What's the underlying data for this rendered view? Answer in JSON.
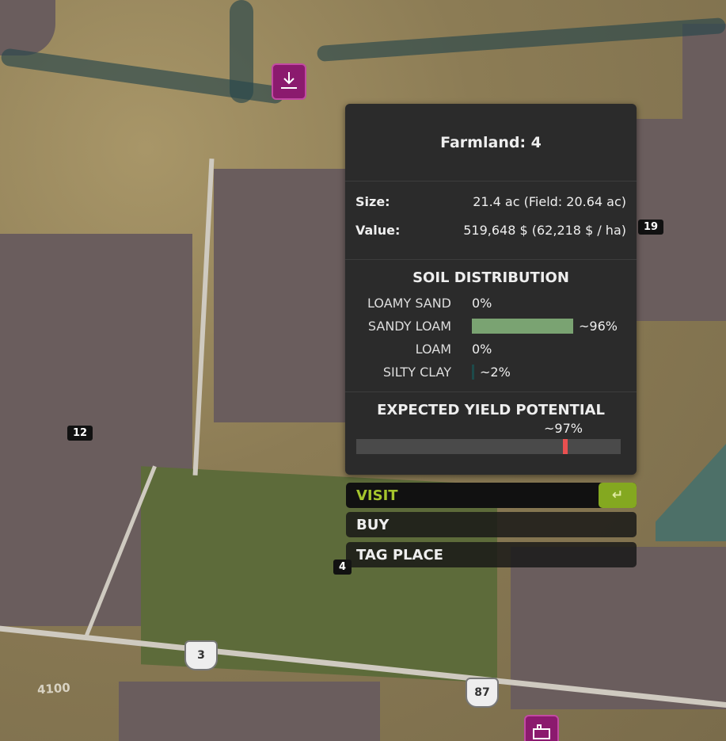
{
  "map": {
    "field_numbers": {
      "left": "12",
      "right": "19",
      "selected": "4"
    },
    "road_shields": {
      "state": "3",
      "us": "87"
    },
    "road_text": "4100",
    "icons": [
      "download-marker-icon",
      "factory-marker-icon"
    ]
  },
  "panel": {
    "title": "Farmland: 4",
    "size_label": "Size:",
    "size_value": "21.4 ac (Field: 20.64 ac)",
    "value_label": "Value:",
    "value_value": "519,648 $ (62,218 $ / ha)"
  },
  "soil": {
    "title": "SOIL DISTRIBUTION",
    "items": [
      {
        "name": "LOAMY SAND",
        "value": "0%",
        "fraction": 0.0
      },
      {
        "name": "SANDY LOAM",
        "value": "~96%",
        "fraction": 0.96
      },
      {
        "name": "LOAM",
        "value": "0%",
        "fraction": 0.0
      },
      {
        "name": "SILTY CLAY",
        "value": "~2%",
        "fraction": 0.02
      }
    ]
  },
  "yield": {
    "title": "EXPECTED YIELD POTENTIAL",
    "value": "~97%",
    "fraction": 0.97
  },
  "actions": {
    "visit": "VISIT",
    "buy": "BUY",
    "tag": "TAG PLACE",
    "enter_icon": "enter-key-icon"
  },
  "colors": {
    "accent": "#a5c52d",
    "soil_bar": "#7aa372",
    "yield_marker": "#e95050",
    "panel_bg": "#2b2b2b"
  }
}
